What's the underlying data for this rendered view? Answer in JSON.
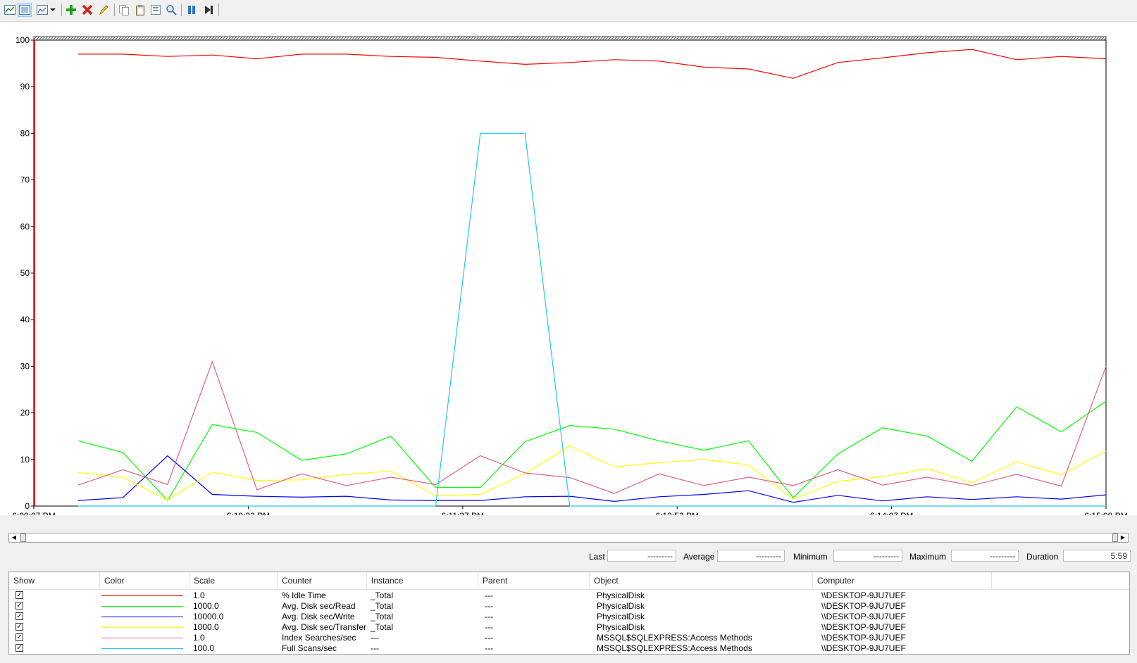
{
  "toolbar": {
    "buttons": [
      {
        "name": "view-current-activity-icon"
      },
      {
        "name": "view-log-data-icon"
      },
      {
        "name": "change-graph-type-icon"
      },
      {
        "name": "add-counter-icon"
      },
      {
        "name": "delete-counter-icon"
      },
      {
        "name": "highlight-icon"
      },
      {
        "name": "copy-properties-icon"
      },
      {
        "name": "paste-counter-list-icon"
      },
      {
        "name": "properties-icon"
      },
      {
        "name": "zoom-icon"
      },
      {
        "name": "freeze-display-icon"
      },
      {
        "name": "update-data-icon"
      }
    ]
  },
  "chart_data": {
    "type": "line",
    "ylim": [
      0,
      100
    ],
    "yticks": [
      "0",
      "10",
      "20",
      "30",
      "40",
      "50",
      "60",
      "70",
      "80",
      "90",
      "100"
    ],
    "xticks": [
      "6:09:07 PM",
      "6:10:22 PM",
      "6:11:37 PM",
      "6:12:52 PM",
      "6:14:07 PM",
      "6:15:08 PM"
    ],
    "grid": false,
    "series": [
      {
        "name": "% Idle Time",
        "color": "#ff0000",
        "values": [
          97,
          97,
          96.5,
          96.8,
          96,
          97,
          97,
          96.5,
          96.3,
          95.5,
          94.8,
          95.2,
          95.8,
          95.5,
          94.2,
          93.8,
          91.8,
          95.2,
          96.2,
          97.3,
          98,
          95.8,
          96.5,
          96
        ]
      },
      {
        "name": "Avg. Disk sec/Read",
        "color": "#00ff00",
        "values": [
          14,
          11.5,
          1.2,
          17.5,
          15.8,
          9.8,
          11.2,
          15,
          4,
          4,
          13.8,
          17.3,
          16.5,
          14,
          12,
          14,
          1.8,
          11.2,
          16.8,
          15,
          9.6,
          21.3,
          15.9,
          22.5
        ]
      },
      {
        "name": "Avg. Disk sec/Write",
        "color": "#0000ff",
        "values": [
          1.2,
          1.8,
          10.8,
          2.5,
          2.1,
          1.9,
          2.1,
          1.3,
          1.2,
          1.2,
          2,
          2.1,
          1,
          2,
          2.5,
          3.3,
          0.8,
          2.3,
          1.1,
          2,
          1.4,
          2,
          1.5,
          2.4
        ]
      },
      {
        "name": "Avg. Disk sec/Transfer",
        "color": "#ffff00",
        "values": [
          7.2,
          6.2,
          1.3,
          7.3,
          5.5,
          5.6,
          6.8,
          7.5,
          2.2,
          2.5,
          7,
          12.9,
          8.4,
          9.3,
          10,
          8.8,
          1.5,
          5.3,
          6.3,
          8,
          5,
          9.5,
          6.7,
          11.8
        ]
      },
      {
        "name": "Index Searches/sec",
        "color": "#e0608a",
        "values": [
          4.5,
          7.8,
          4.6,
          31,
          3.5,
          6.9,
          4.4,
          6.2,
          4.6,
          10.8,
          7.1,
          6.1,
          2.7,
          6.9,
          4.4,
          6.2,
          4.4,
          7.8,
          4.5,
          6.2,
          4.4,
          6.8,
          4.3,
          30
        ]
      },
      {
        "name": "Full Scans/sec",
        "color": "#1ecbf0",
        "values": [
          0,
          0,
          0,
          0,
          0,
          0,
          0,
          0,
          0,
          80,
          80,
          0,
          0,
          0,
          0,
          0,
          0,
          0,
          0,
          0,
          0,
          0,
          0,
          0
        ]
      }
    ]
  },
  "stats": {
    "last_label": "Last",
    "last_value": "---------",
    "average_label": "Average",
    "average_value": "---------",
    "minimum_label": "Minimum",
    "minimum_value": "---------",
    "maximum_label": "Maximum",
    "maximum_value": "---------",
    "duration_label": "Duration",
    "duration_value": "5:59"
  },
  "legend": {
    "headers": [
      "Show",
      "Color",
      "Scale",
      "Counter",
      "Instance",
      "Parent",
      "Object",
      "Computer"
    ],
    "rows": [
      {
        "checked": "✓",
        "color": "#ff0000",
        "scale": "1.0",
        "counter": "% Idle Time",
        "instance": "_Total",
        "parent": "---",
        "object": "PhysicalDisk",
        "computer": "\\\\DESKTOP-9JU7UEF"
      },
      {
        "checked": "✓",
        "color": "#00ff00",
        "scale": "1000.0",
        "counter": "Avg. Disk sec/Read",
        "instance": "_Total",
        "parent": "---",
        "object": "PhysicalDisk",
        "computer": "\\\\DESKTOP-9JU7UEF"
      },
      {
        "checked": "✓",
        "color": "#0000ff",
        "scale": "10000.0",
        "counter": "Avg. Disk sec/Write",
        "instance": "_Total",
        "parent": "---",
        "object": "PhysicalDisk",
        "computer": "\\\\DESKTOP-9JU7UEF"
      },
      {
        "checked": "✓",
        "color": "#ffff00",
        "scale": "1000.0",
        "counter": "Avg. Disk sec/Transfer",
        "instance": "_Total",
        "parent": "---",
        "object": "PhysicalDisk",
        "computer": "\\\\DESKTOP-9JU7UEF"
      },
      {
        "checked": "✓",
        "color": "#e0608a",
        "scale": "1.0",
        "counter": "Index Searches/sec",
        "instance": "---",
        "parent": "---",
        "object": "MSSQL$SQLEXPRESS:Access Methods",
        "computer": "\\\\DESKTOP-9JU7UEF"
      },
      {
        "checked": "✓",
        "color": "#1ecbf0",
        "scale": "100.0",
        "counter": "Full Scans/sec",
        "instance": "---",
        "parent": "---",
        "object": "MSSQL$SQLEXPRESS:Access Methods",
        "computer": "\\\\DESKTOP-9JU7UEF"
      }
    ]
  }
}
